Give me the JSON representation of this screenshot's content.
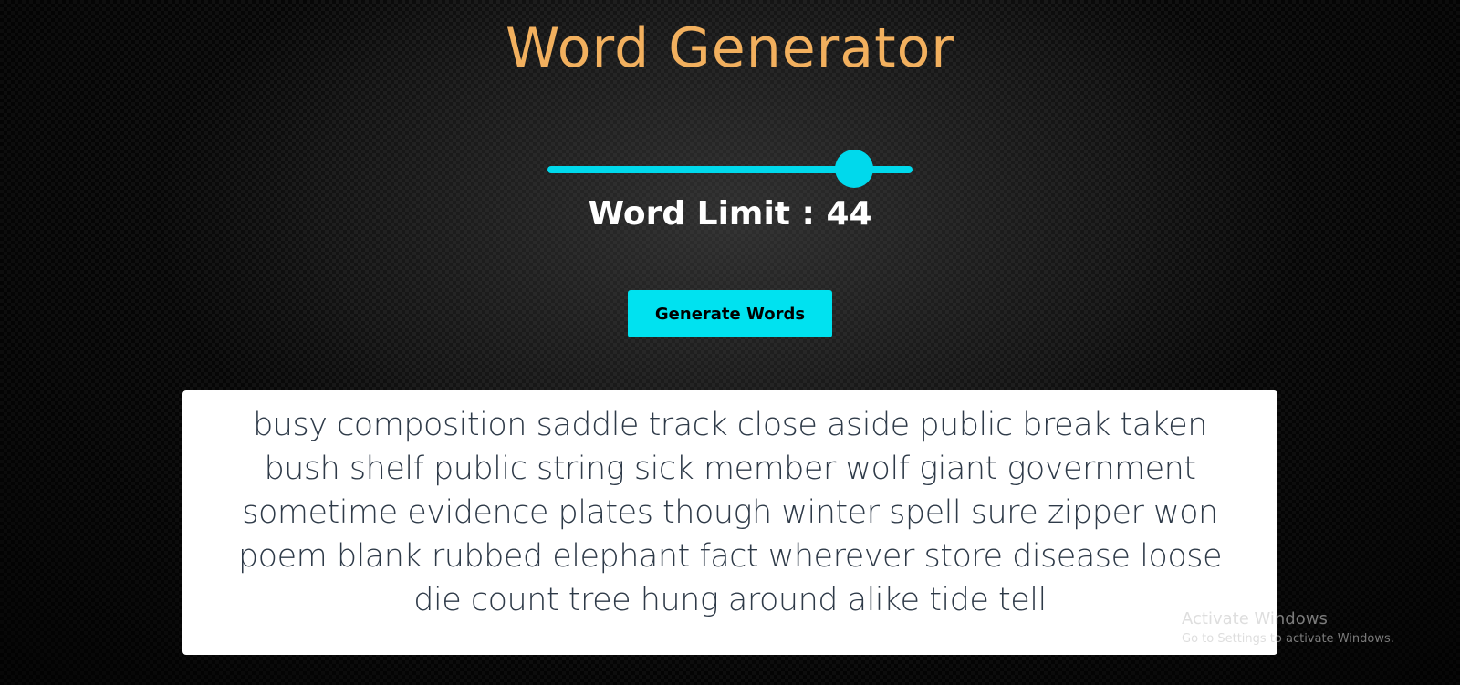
{
  "header": {
    "title": "Word Generator"
  },
  "slider": {
    "value": 44,
    "fraction": 0.84,
    "accent_color": "#00d9ec"
  },
  "word_limit": {
    "label": "Word Limit : 44"
  },
  "generate": {
    "label": "Generate Words"
  },
  "output": {
    "text": "busy composition saddle track close aside public break taken bush shelf public string sick member wolf giant government sometime evidence plates though winter spell sure zipper won poem blank rubbed elephant fact wherever store disease loose die count tree hung around alike tide tell"
  },
  "watermark": {
    "title": "Activate Windows",
    "subtitle": "Go to Settings to activate Windows."
  },
  "colors": {
    "title": "#f2b05e",
    "accent": "#00e2f0",
    "output_text": "#2e3a48"
  }
}
